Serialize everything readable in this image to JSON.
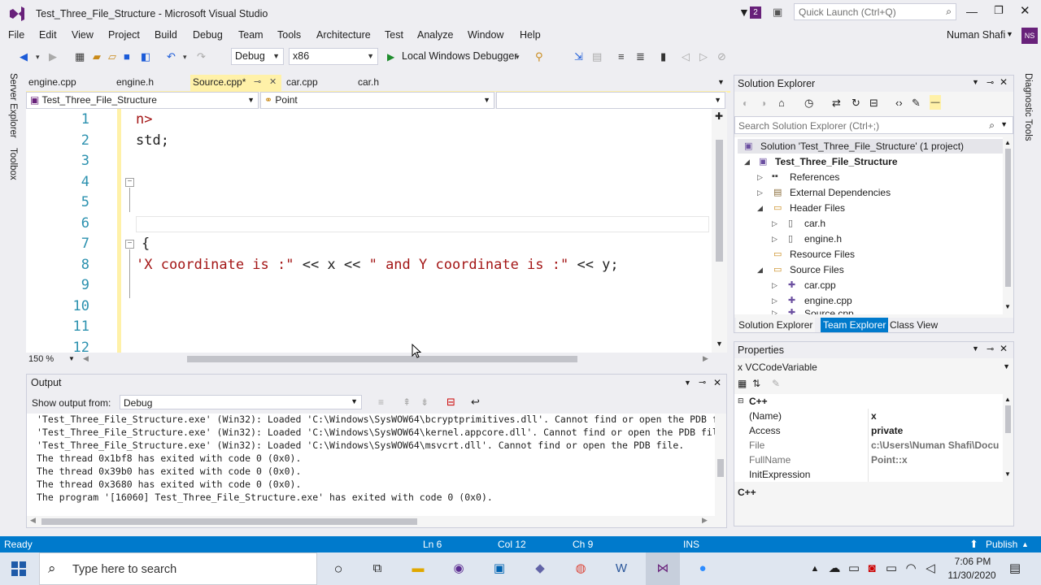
{
  "window": {
    "title": "Test_Three_File_Structure - Microsoft Visual Studio",
    "notification_count": "2",
    "quick_launch_placeholder": "Quick Launch (Ctrl+Q)",
    "user_name": "Numan Shafi",
    "user_initials": "NS"
  },
  "menu": [
    "File",
    "Edit",
    "View",
    "Project",
    "Build",
    "Debug",
    "Team",
    "Tools",
    "Architecture",
    "Test",
    "Analyze",
    "Window",
    "Help"
  ],
  "toolbar": {
    "configuration": "Debug",
    "platform": "x86",
    "debugger": "Local Windows Debugger"
  },
  "left_strip": {
    "server_explorer": "Server Explorer",
    "toolbox": "Toolbox"
  },
  "right_strip": {
    "diagnostic_tools": "Diagnostic Tools"
  },
  "doc_tabs": [
    "engine.cpp",
    "engine.h",
    "Source.cpp*",
    "car.cpp",
    "car.h"
  ],
  "nav": {
    "project": "Test_Three_File_Structure",
    "scope": "Point",
    "member": ""
  },
  "editor": {
    "line_numbers": [
      "1",
      "2",
      "3",
      "4",
      "5",
      "6",
      "7",
      "8",
      "9",
      "10",
      "11",
      "12"
    ],
    "line1": "n>",
    "line2": "std;",
    "line7": "{",
    "line8_str1": "'X coordinate is :\"",
    "line8_op1": " << x << ",
    "line8_str2": "\" and Y coordinate is :\"",
    "line8_op2": " << y;",
    "zoom": "150 %"
  },
  "output": {
    "title": "Output",
    "show_from_label": "Show output from:",
    "show_from_value": "Debug",
    "lines": [
      "'Test_Three_File_Structure.exe' (Win32): Loaded 'C:\\Windows\\SysWOW64\\bcryptprimitives.dll'. Cannot find or open the PDB file.",
      "'Test_Three_File_Structure.exe' (Win32): Loaded 'C:\\Windows\\SysWOW64\\kernel.appcore.dll'. Cannot find or open the PDB file.",
      "'Test_Three_File_Structure.exe' (Win32): Loaded 'C:\\Windows\\SysWOW64\\msvcrt.dll'. Cannot find or open the PDB file.",
      "The thread 0x1bf8 has exited with code 0 (0x0).",
      "The thread 0x39b0 has exited with code 0 (0x0).",
      "The thread 0x3680 has exited with code 0 (0x0).",
      "The program '[16060] Test_Three_File_Structure.exe' has exited with code 0 (0x0)."
    ]
  },
  "solution_explorer": {
    "title": "Solution Explorer",
    "search_placeholder": "Search Solution Explorer (Ctrl+;)",
    "solution": "Solution 'Test_Three_File_Structure' (1 project)",
    "project": "Test_Three_File_Structure",
    "references": "References",
    "external_deps": "External Dependencies",
    "header_files": "Header Files",
    "car_h": "car.h",
    "engine_h": "engine.h",
    "resource_files": "Resource Files",
    "source_files": "Source Files",
    "car_cpp": "car.cpp",
    "engine_cpp": "engine.cpp",
    "source_cpp": "Source.cpp",
    "tabs": [
      "Solution Explorer",
      "Team Explorer",
      "Class View"
    ]
  },
  "properties": {
    "title": "Properties",
    "object": "x VCCodeVariable",
    "category": "C++",
    "rows": [
      {
        "name": "(Name)",
        "value": "x"
      },
      {
        "name": "Access",
        "value": "private"
      },
      {
        "name": "File",
        "value": "c:\\Users\\Numan Shafi\\Docu"
      },
      {
        "name": "FullName",
        "value": "Point::x"
      },
      {
        "name": "InitExpression",
        "value": ""
      }
    ],
    "description": "C++"
  },
  "status": {
    "state": "Ready",
    "line": "Ln 6",
    "col": "Col 12",
    "ch": "Ch 9",
    "mode": "INS",
    "publish": "Publish"
  },
  "taskbar": {
    "search_placeholder": "Type here to search",
    "time": "7:06 PM",
    "date": "11/30/2020"
  },
  "colors": {
    "accent": "#007acc",
    "vs_purple": "#68217a",
    "active_tab": "#fff1a8"
  }
}
